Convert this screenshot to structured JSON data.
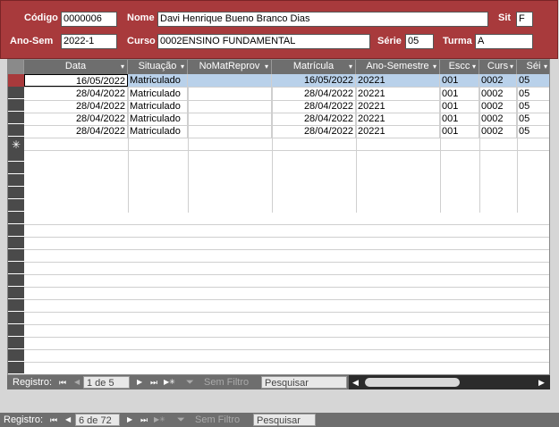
{
  "form": {
    "codigo_label": "Código",
    "codigo_value": "0000006",
    "nome_label": "Nome",
    "nome_value": "Davi Henrique Bueno Branco Dias",
    "sit_label": "Sit",
    "sit_value": "F",
    "anosem_label": "Ano-Sem",
    "anosem_value": "2022-1",
    "curso_label": "Curso",
    "curso_value": "0002ENSINO FUNDAMENTAL",
    "serie_label": "Série",
    "serie_value": "05",
    "turma_label": "Turma",
    "turma_value": "A"
  },
  "grid": {
    "columns": [
      {
        "label": "Data"
      },
      {
        "label": "Situação"
      },
      {
        "label": "NoMatReprov"
      },
      {
        "label": "Matrícula"
      },
      {
        "label": "Ano-Semestre"
      },
      {
        "label": "Escc"
      },
      {
        "label": "Curs"
      },
      {
        "label": "Séi"
      }
    ],
    "rows": [
      {
        "data": "16/05/2022",
        "situacao": "Matriculado",
        "nomat": "",
        "matricula": "16/05/2022",
        "anosem": "20221",
        "escola": "001",
        "curso": "0002",
        "serie": "05"
      },
      {
        "data": "28/04/2022",
        "situacao": "Matriculado",
        "nomat": "",
        "matricula": "28/04/2022",
        "anosem": "20221",
        "escola": "001",
        "curso": "0002",
        "serie": "05"
      },
      {
        "data": "28/04/2022",
        "situacao": "Matriculado",
        "nomat": "",
        "matricula": "28/04/2022",
        "anosem": "20221",
        "escola": "001",
        "curso": "0002",
        "serie": "05"
      },
      {
        "data": "28/04/2022",
        "situacao": "Matriculado",
        "nomat": "",
        "matricula": "28/04/2022",
        "anosem": "20221",
        "escola": "001",
        "curso": "0002",
        "serie": "05"
      },
      {
        "data": "28/04/2022",
        "situacao": "Matriculado",
        "nomat": "",
        "matricula": "28/04/2022",
        "anosem": "20221",
        "escola": "001",
        "curso": "0002",
        "serie": "05"
      }
    ],
    "new_row_symbol": "✳"
  },
  "subnav": {
    "registro_label": "Registro:",
    "position": "1 de 5",
    "filter_label": "Sem Filtro",
    "search_placeholder": "Pesquisar"
  },
  "mainnav": {
    "registro_label": "Registro:",
    "position": "6 de 72",
    "filter_label": "Sem Filtro",
    "search_placeholder": "Pesquisar"
  },
  "icons": {
    "first": "⏮",
    "prev": "◀",
    "next": "▶",
    "last": "⏭",
    "new": "▶✳",
    "filter": "filter-icon"
  }
}
